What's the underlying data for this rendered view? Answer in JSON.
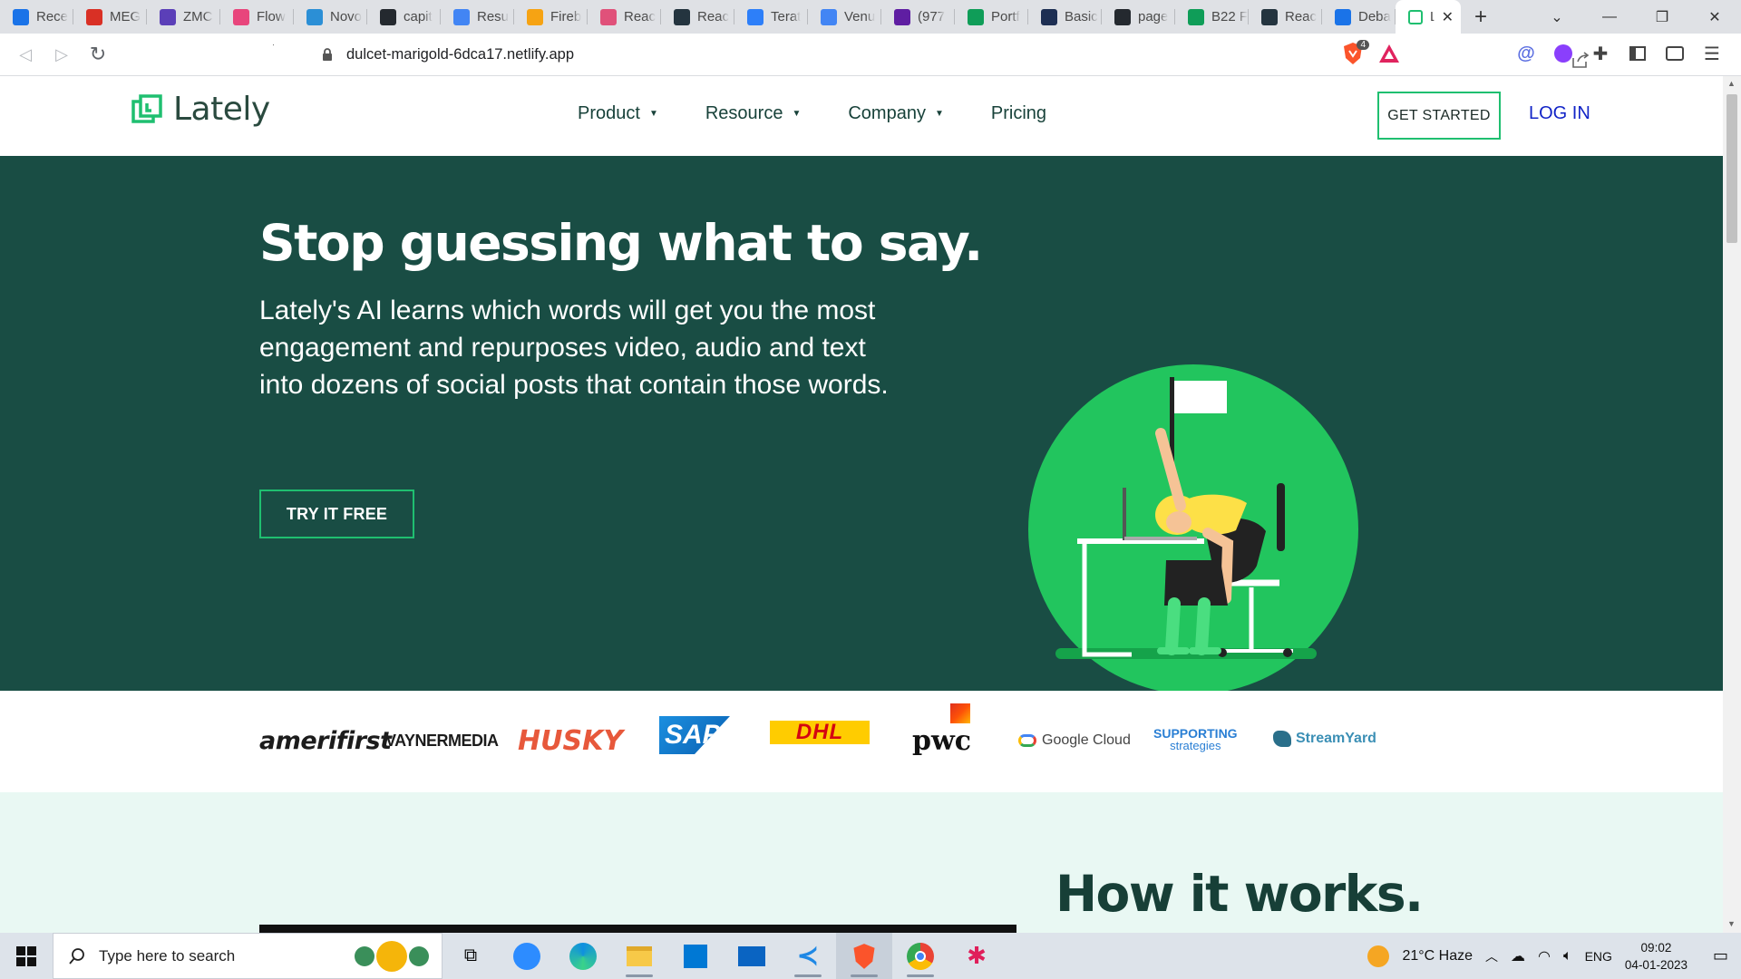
{
  "browser": {
    "tabs": [
      {
        "title": "Rece",
        "color": "#1a73e8",
        "icon": "google-drive-icon"
      },
      {
        "title": "MEG",
        "color": "#d93025",
        "icon": "gmail-icon"
      },
      {
        "title": "ZMC",
        "color": "#5b3fb8",
        "icon": "forms-icon"
      },
      {
        "title": "Flow",
        "color": "#e8457c",
        "icon": "flow-icon"
      },
      {
        "title": "Novo",
        "color": "#2b8fd6",
        "icon": "notion-like-icon"
      },
      {
        "title": "capit",
        "color": "#24292f",
        "icon": "github-icon"
      },
      {
        "title": "Resu",
        "color": "#4285f4",
        "icon": "docs-icon"
      },
      {
        "title": "Fireb",
        "color": "#f6a313",
        "icon": "firebase-icon"
      },
      {
        "title": "Reac",
        "color": "#e0517a",
        "icon": "react-icon"
      },
      {
        "title": "Reac",
        "color": "#24343f",
        "icon": "react-icon"
      },
      {
        "title": "Terat",
        "color": "#2d7ff9",
        "icon": "terabox-icon"
      },
      {
        "title": "Venu",
        "color": "#4285f4",
        "icon": "docs-icon"
      },
      {
        "title": "(977",
        "color": "#5f1ea2",
        "icon": "mail-icon"
      },
      {
        "title": "Portf",
        "color": "#0f9d58",
        "icon": "sheets-icon"
      },
      {
        "title": "Basic",
        "color": "#1d2f53",
        "icon": "h-icon"
      },
      {
        "title": "page",
        "color": "#24292f",
        "icon": "github-icon"
      },
      {
        "title": "B22 F",
        "color": "#0f9d58",
        "icon": "sheets-icon"
      },
      {
        "title": "Reac",
        "color": "#24343f",
        "icon": "react-icon"
      },
      {
        "title": "Deba",
        "color": "#1a73e8",
        "icon": "google-drive-icon"
      }
    ],
    "active_tab": {
      "title": "La",
      "icon": "lately-icon"
    },
    "new_tab": "+",
    "url": "dulcet-marigold-6dca17.netlify.app",
    "brave_shield_count": "4"
  },
  "site": {
    "brand": "Lately",
    "nav": [
      {
        "label": "Product",
        "caret": "▼"
      },
      {
        "label": "Resource",
        "caret": "▼"
      },
      {
        "label": "Company",
        "caret": "▼"
      },
      {
        "label": "Pricing",
        "caret": ""
      }
    ],
    "get_started": "GET STARTED",
    "login": "LOG IN",
    "hero": {
      "title": "Stop guessing what to say.",
      "body": "Lately's AI learns which words will get you the most engagement and repurposes video, audio and text into dozens of social posts that contain those words.",
      "cta": "TRY IT FREE"
    },
    "logos": [
      "amerifirst",
      "VAYNERMEDIA",
      "HUSKY",
      "SAP",
      "DHL",
      "pwc",
      "Google Cloud",
      "SUPPORTING",
      "strategies",
      "StreamYard"
    ],
    "how_title": "How it works."
  },
  "colors": {
    "hero_bg": "#194d44",
    "accent_green": "#1fbf70",
    "login_blue": "#1224c7",
    "how_bg": "#e9f8f3"
  },
  "taskbar": {
    "search_placeholder": "Type here to search",
    "weather": "21°C  Haze",
    "lang": "ENG",
    "time": "09:02",
    "date": "04-01-2023"
  }
}
